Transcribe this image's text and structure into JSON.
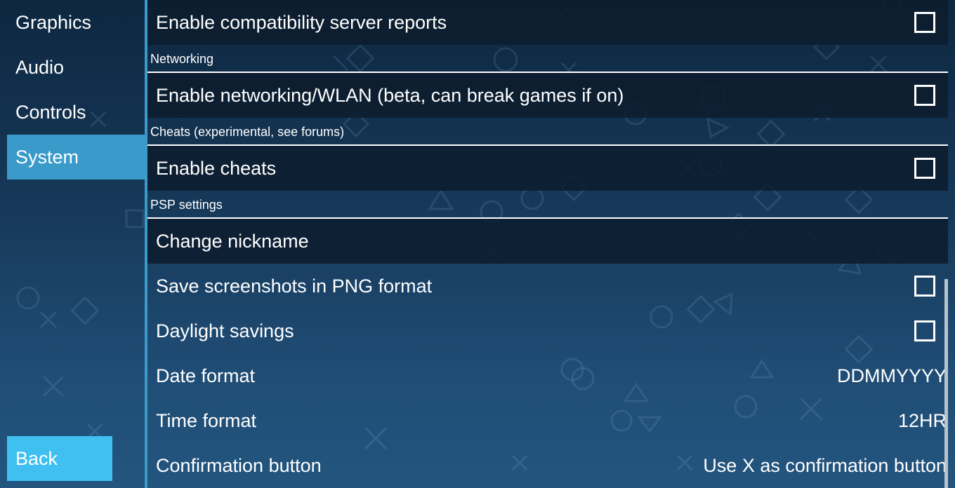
{
  "sidebar": {
    "items": [
      {
        "label": "Graphics"
      },
      {
        "label": "Audio"
      },
      {
        "label": "Controls"
      },
      {
        "label": "System",
        "active": true
      }
    ],
    "back_label": "Back"
  },
  "settings": {
    "compat_reports": {
      "label": "Enable compatibility server reports",
      "checked": false
    },
    "networking_header": "Networking",
    "networking": {
      "label": "Enable networking/WLAN (beta, can break games if on)",
      "checked": false
    },
    "cheats_header": "Cheats (experimental, see forums)",
    "cheats": {
      "label": "Enable cheats",
      "checked": false
    },
    "psp_header": "PSP settings",
    "nickname": {
      "label": "Change nickname"
    },
    "png_screenshots": {
      "label": "Save screenshots in PNG format",
      "checked": false
    },
    "daylight_savings": {
      "label": "Daylight savings",
      "checked": false
    },
    "date_format": {
      "label": "Date format",
      "value": "DDMMYYYY"
    },
    "time_format": {
      "label": "Time format",
      "value": "12HR"
    },
    "confirmation_button": {
      "label": "Confirmation button",
      "value": "Use X as confirmation button"
    }
  },
  "colors": {
    "accent": "#3a9ac9",
    "back_button": "#3fc0f1",
    "background_top": "#0d2740",
    "background_bottom": "#23557f"
  }
}
